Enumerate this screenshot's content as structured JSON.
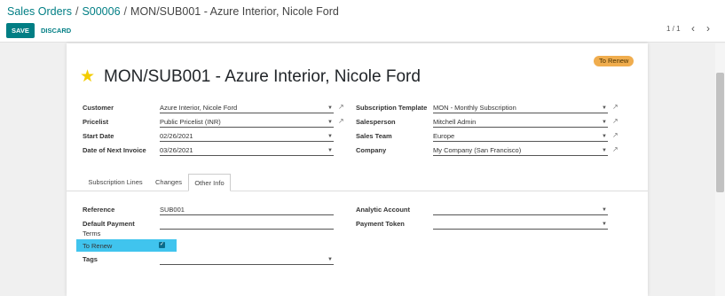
{
  "breadcrumb": {
    "sales_orders": "Sales Orders",
    "order": "S00006",
    "current": "MON/SUB001 - Azure Interior, Nicole Ford",
    "separator": "/"
  },
  "toolbar": {
    "save_label": "SAVE",
    "discard_label": "DISCARD"
  },
  "pager": {
    "value": "1 / 1",
    "prev": "‹",
    "next": "›"
  },
  "status_badge": "To Renew",
  "record_title": "MON/SUB001 - Azure Interior, Nicole Ford",
  "fields": {
    "customer": {
      "label": "Customer",
      "value": "Azure Interior, Nicole Ford"
    },
    "pricelist": {
      "label": "Pricelist",
      "value": "Public Pricelist (INR)"
    },
    "start_date": {
      "label": "Start Date",
      "value": "02/26/2021"
    },
    "next_invoice": {
      "label": "Date of Next Invoice",
      "value": "03/26/2021"
    },
    "template": {
      "label": "Subscription Template",
      "value": "MON - Monthly Subscription"
    },
    "salesperson": {
      "label": "Salesperson",
      "value": "Mitchell Admin"
    },
    "sales_team": {
      "label": "Sales Team",
      "value": "Europe"
    },
    "company": {
      "label": "Company",
      "value": "My Company (San Francisco)"
    }
  },
  "tabs": [
    {
      "label": "Subscription Lines"
    },
    {
      "label": "Changes"
    },
    {
      "label": "Other Info"
    }
  ],
  "other_info": {
    "reference": {
      "label": "Reference",
      "value": "SUB001"
    },
    "payment_terms": {
      "label1": "Default Payment",
      "label2": "Terms",
      "value": ""
    },
    "to_renew": {
      "label": "To Renew",
      "checked": true,
      "check_glyph": "✓"
    },
    "tags": {
      "label": "Tags",
      "value": ""
    },
    "analytic_account": {
      "label": "Analytic Account",
      "value": ""
    },
    "payment_token": {
      "label": "Payment Token",
      "value": ""
    }
  },
  "colors": {
    "accent": "#017e84",
    "badge": "#f0ad4e",
    "highlight": "#40c4ee",
    "star": "#f3cc00"
  }
}
